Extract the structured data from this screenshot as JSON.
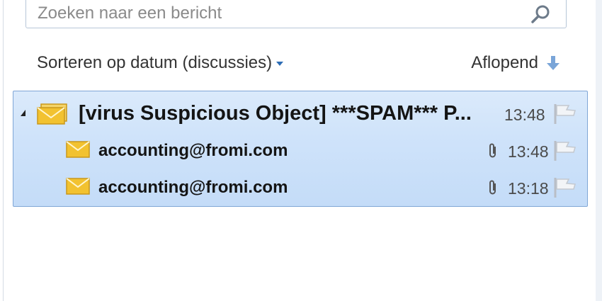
{
  "search": {
    "placeholder": "Zoeken naar een bericht"
  },
  "sort": {
    "by_label": "Sorteren op datum (discussies)",
    "order_label": "Aflopend"
  },
  "conversation": {
    "subject": "[virus Suspicious Object] ***SPAM*** P...",
    "time": "13:48",
    "messages": [
      {
        "sender": "accounting@fromi.com",
        "time": "13:48"
      },
      {
        "sender": "accounting@fromi.com",
        "time": "13:18"
      }
    ]
  },
  "colors": {
    "selection_bg": "#cfe3fa",
    "selection_border": "#7fa6d6",
    "envelope": "#f2c230",
    "accent_arrow": "#7aa5d8"
  },
  "icons": [
    "search-icon",
    "sort-caret-icon",
    "arrow-down-icon",
    "expand-triangle-icon",
    "envelope-icon",
    "paperclip-icon",
    "flag-icon"
  ]
}
